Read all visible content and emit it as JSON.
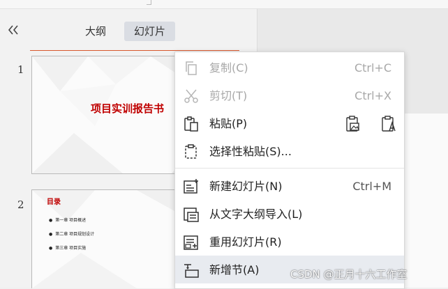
{
  "panel": {
    "tabs": [
      {
        "label": "大纲",
        "active": false
      },
      {
        "label": "幻灯片",
        "active": true
      }
    ],
    "collapse_icon": "double-chevron-left-icon"
  },
  "slides": [
    {
      "number": "1",
      "title": "项目实训报告书"
    },
    {
      "number": "2",
      "title": "目录",
      "items": [
        "第一章 项目概述",
        "第二章 项目规划设计",
        "第三章 项目实施"
      ]
    }
  ],
  "context_menu": {
    "items": [
      {
        "label": "复制(C)",
        "shortcut": "Ctrl+C",
        "icon": "copy-icon",
        "enabled": false
      },
      {
        "label": "剪切(T)",
        "shortcut": "Ctrl+X",
        "icon": "cut-icon",
        "enabled": false
      },
      {
        "label": "粘贴(P)",
        "shortcut": "",
        "icon": "paste-icon",
        "enabled": true,
        "paste_options": [
          "paste-as-picture-icon",
          "paste-text-only-icon"
        ]
      },
      {
        "label": "选择性粘贴(S)...",
        "shortcut": "",
        "icon": "paste-special-icon",
        "enabled": true
      },
      {
        "label": "新建幻灯片(N)",
        "shortcut": "Ctrl+M",
        "icon": "new-slide-icon",
        "enabled": true
      },
      {
        "label": "从文字大纲导入(L)",
        "shortcut": "",
        "icon": "import-outline-icon",
        "enabled": true
      },
      {
        "label": "重用幻灯片(R)",
        "shortcut": "",
        "icon": "reuse-slide-icon",
        "enabled": true
      },
      {
        "label": "新增节(A)",
        "shortcut": "",
        "icon": "add-section-icon",
        "enabled": true,
        "highlighted": true
      }
    ]
  },
  "watermark": "CSDN @正月十六工作室",
  "colors": {
    "accent_red": "#c00000",
    "active_tab_bg": "#dadde3",
    "menu_hover_bg": "#e8ebf0",
    "selection_line": "#d8572c"
  }
}
